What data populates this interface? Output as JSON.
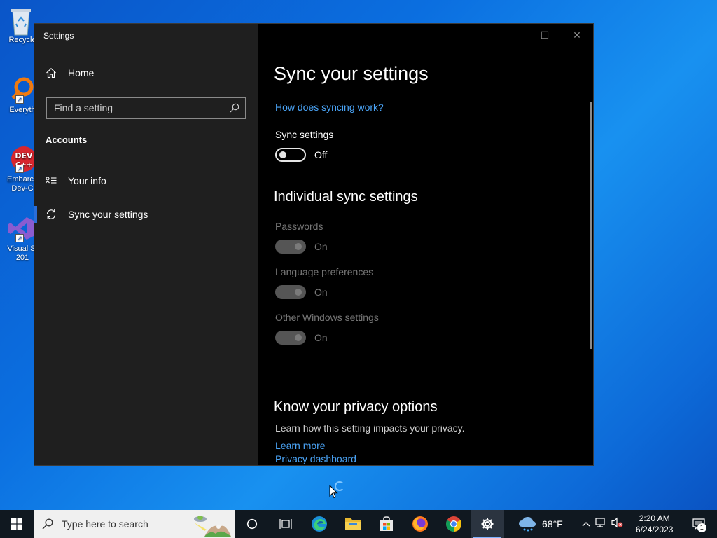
{
  "desktop": {
    "icons": [
      {
        "label": "Recycle"
      },
      {
        "label": "Everyth"
      },
      {
        "label": "Embarca Dev-C"
      },
      {
        "label": "Visual St 201"
      }
    ]
  },
  "window": {
    "title": "Settings",
    "controls": {
      "minimize": "—",
      "maximize": "☐",
      "close": "✕"
    }
  },
  "sidebar": {
    "home_label": "Home",
    "search_placeholder": "Find a setting",
    "section": "Accounts",
    "items": [
      {
        "label": "Your info",
        "active": false
      },
      {
        "label": "Sync your settings",
        "active": true
      }
    ]
  },
  "main": {
    "title": "Sync your settings",
    "how_link": "How does syncing work?",
    "sync_label": "Sync settings",
    "sync_state": "Off",
    "individual_heading": "Individual sync settings",
    "individual": [
      {
        "label": "Passwords",
        "state": "On"
      },
      {
        "label": "Language preferences",
        "state": "On"
      },
      {
        "label": "Other Windows settings",
        "state": "On"
      }
    ],
    "privacy_heading": "Know your privacy options",
    "privacy_text": "Learn how this setting impacts your privacy.",
    "learn_more": "Learn more",
    "privacy_dashboard": "Privacy dashboard"
  },
  "taskbar": {
    "search_placeholder": "Type here to search",
    "weather": "68°F",
    "time": "2:20 AM",
    "date": "6/24/2023",
    "notification_count": "1"
  },
  "colors": {
    "accent": "#2a6dd8",
    "link": "#4aa3f5"
  }
}
